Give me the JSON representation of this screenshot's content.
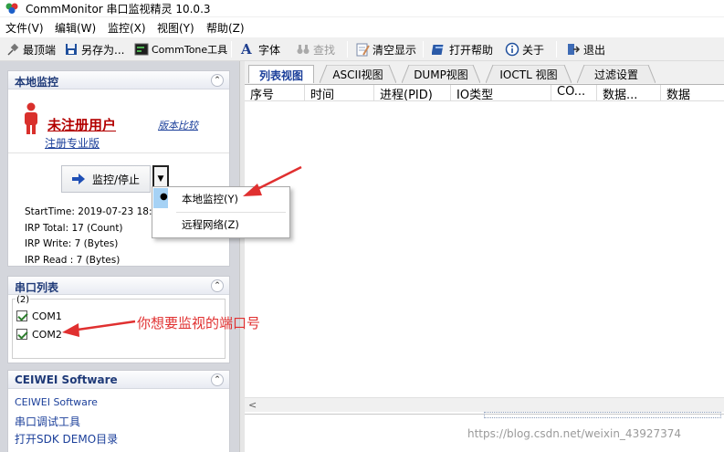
{
  "window": {
    "title": "CommMonitor 串口监视精灵 10.0.3"
  },
  "menu": [
    "文件(V)",
    "编辑(W)",
    "监控(X)",
    "视图(Y)",
    "帮助(Z)"
  ],
  "toolbar": {
    "topmost": "最顶端",
    "save_as": "另存为...",
    "commtone": "CommTone工具",
    "font": "字体",
    "find": "查找",
    "clear": "清空显示",
    "open_help": "打开帮助",
    "about": "关于",
    "exit": "退出"
  },
  "local_monitor": {
    "header": "本地监控",
    "user": "未注册用户",
    "compare": "版本比较",
    "register": "注册专业版",
    "monitor_button": "监控/停止",
    "start_time": "StartTime: 2019-07-23 18:37",
    "irp_total": "IRP Total: 17 (Count)",
    "irp_write": "IRP Write: 7 (Bytes)",
    "irp_read": "IRP Read : 7 (Bytes)"
  },
  "dropdown_menu": {
    "local": "本地监控(Y)",
    "remote": "远程网络(Z)"
  },
  "port_list": {
    "header": "串口列表",
    "count": "(2)",
    "ports": [
      {
        "label": "COM1",
        "checked": true
      },
      {
        "label": "COM2",
        "checked": true
      }
    ]
  },
  "ceiwei": {
    "header": "CEIWEI Software",
    "links": [
      "CEIWEI Software",
      "串口调试工具",
      "打开SDK DEMO目录"
    ]
  },
  "tabs": [
    "列表视图",
    "ASCII视图",
    "DUMP视图",
    "IOCTL 视图",
    "过滤设置"
  ],
  "columns": [
    "序号",
    "时间",
    "进程(PID)",
    "IO类型",
    "CO...",
    "数据...",
    "数据"
  ],
  "annotation": "你想要监视的端口号",
  "watermark": "https://blog.csdn.net/weixin_43927374",
  "colors": {
    "accent_red": "#e03030",
    "user_red": "#c00000",
    "link_blue": "#1b3f9a",
    "panel_title": "#1f3a78"
  }
}
